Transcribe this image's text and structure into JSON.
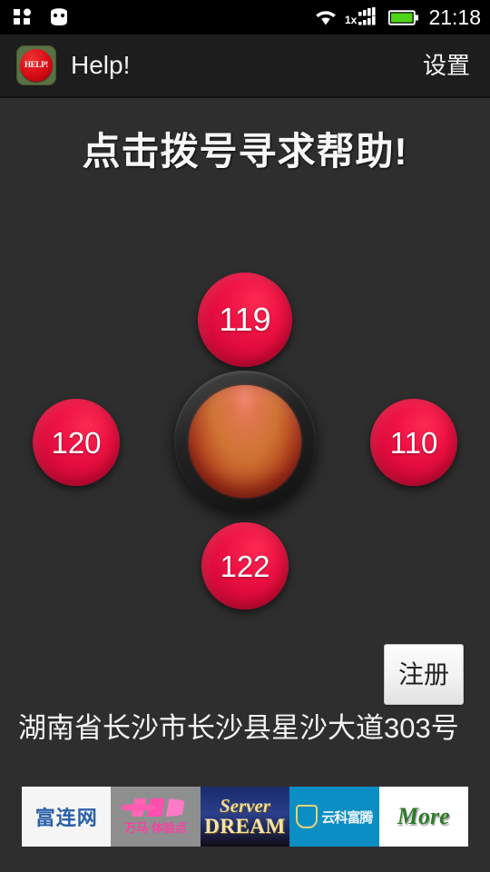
{
  "status_bar": {
    "left_icons": [
      "apps-grid-icon",
      "android-robot-icon"
    ],
    "right_icons": [
      "wifi-icon",
      "cellular-1x-signal-icon",
      "battery-icon"
    ],
    "network_label": "1x",
    "clock": "21:18",
    "battery_color": "#4fd319"
  },
  "action_bar": {
    "logo_text": "HELP!",
    "title": "Help!",
    "settings_label": "设置"
  },
  "main": {
    "headline": "点击拨号寻求帮助!",
    "dial_buttons": [
      {
        "id": "119",
        "label": "119",
        "position": "top"
      },
      {
        "id": "120",
        "label": "120",
        "position": "left"
      },
      {
        "id": "110",
        "label": "110",
        "position": "right"
      },
      {
        "id": "122",
        "label": "122",
        "position": "bottom"
      }
    ],
    "center_button": {
      "name": "sos-dial-button",
      "label": ""
    },
    "register_label": "注册",
    "address": "湖南省长沙市长沙县星沙大道303号"
  },
  "ads": {
    "tiles": [
      {
        "name": "ad-fulianwang",
        "text": "富连网"
      },
      {
        "name": "ad-wanma",
        "text": "万马 体验点"
      },
      {
        "name": "ad-server-dream",
        "line1": "Server",
        "line2": "DREAM"
      },
      {
        "name": "ad-yunke-futeng",
        "text": "云科富腾"
      },
      {
        "name": "ad-more",
        "text": "More"
      }
    ]
  },
  "colors": {
    "background": "#2e2e2e",
    "action_bar": "#1d1d1d",
    "button_red": "#e0103f",
    "center_dome": "#c4642b"
  }
}
